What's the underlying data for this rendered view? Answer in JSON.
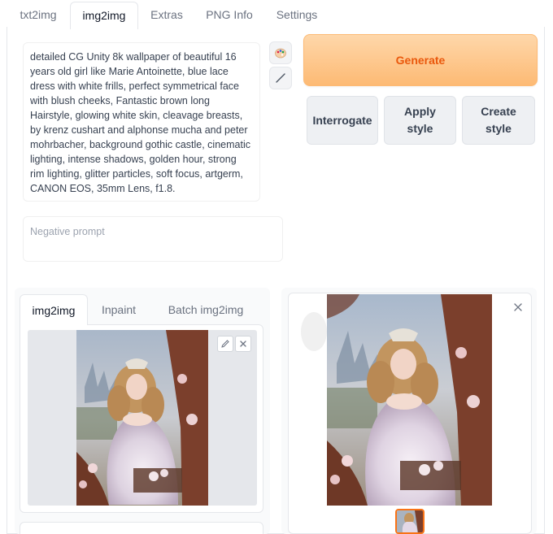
{
  "top_tabs": [
    "txt2img",
    "img2img",
    "Extras",
    "PNG Info",
    "Settings"
  ],
  "active_top_tab": "img2img",
  "prompt": {
    "text": "detailed CG Unity 8k wallpaper of beautiful 16 years old girl like Marie Antoinette, blue lace dress with white frills, perfect symmetrical face with blush cheeks, Fantastic brown long Hairstyle, glowing white skin, cleavage breasts, by krenz cushart and alphonse mucha and peter mohrbacher, background gothic castle, cinematic lighting, intense shadows, golden hour, strong rim lighting, glitter particles, soft focus, artgerm, CANON EOS, 35mm Lens, f1.8."
  },
  "negative_prompt": {
    "placeholder": "Negative prompt",
    "value": ""
  },
  "buttons": {
    "generate": "Generate",
    "interrogate": "Interrogate",
    "apply_style": "Apply style",
    "create_style": "Create style"
  },
  "sub_tabs": [
    "img2img",
    "Inpaint",
    "Batch img2img"
  ],
  "active_sub_tab": "img2img",
  "icons": {
    "palette": "palette-icon",
    "brush": "paint-brush-icon",
    "edit": "pencil-icon",
    "close": "close-icon"
  },
  "colors": {
    "generate_bg": "#fdba74",
    "generate_text": "#ea580c",
    "gallery_selected_border": "#f97316"
  }
}
